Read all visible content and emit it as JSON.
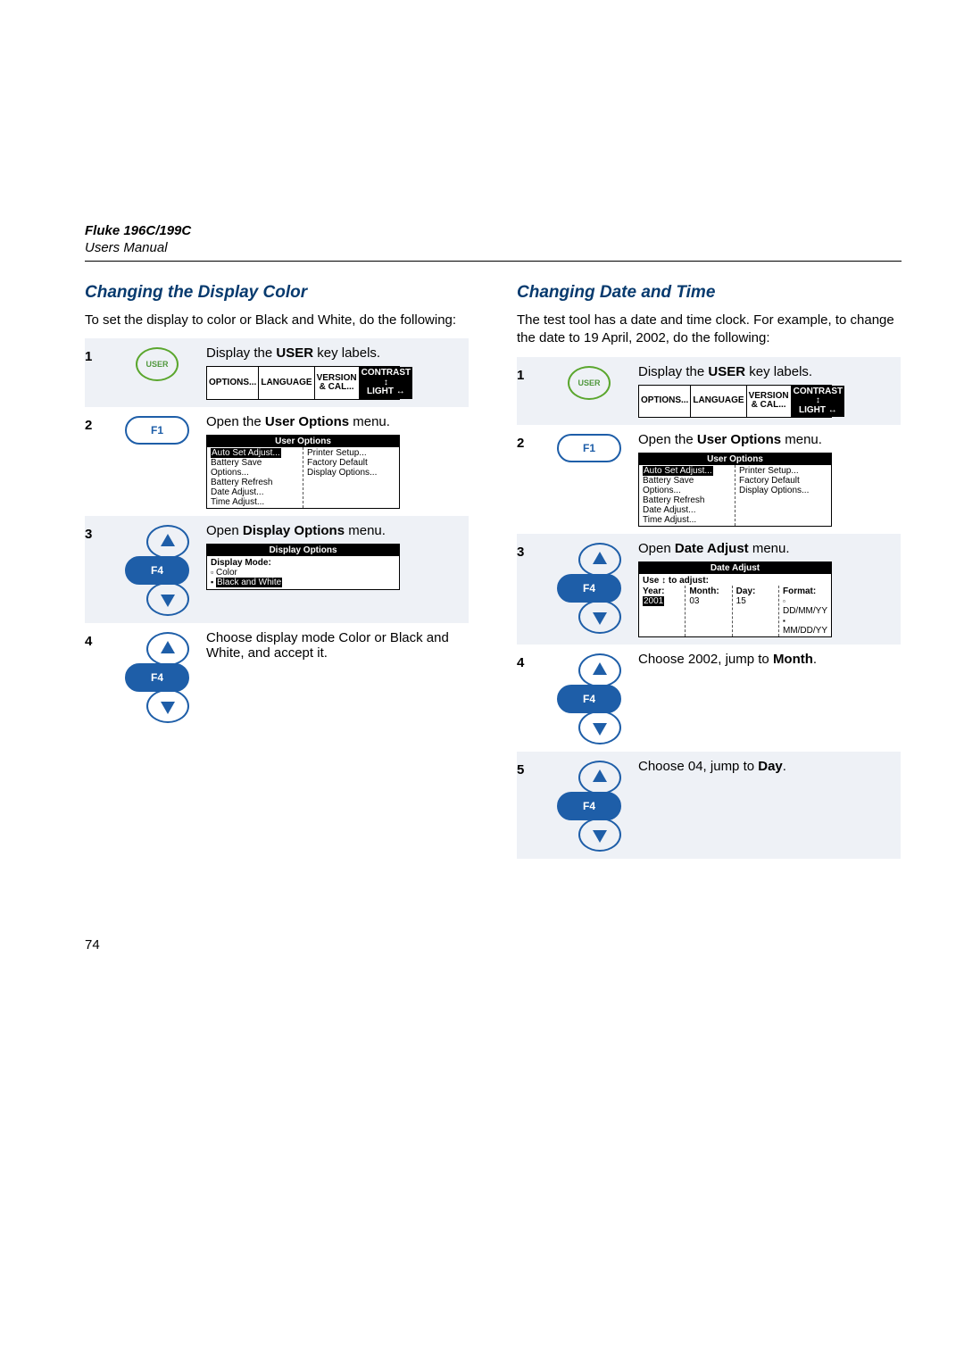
{
  "header": {
    "model": "Fluke 196C/199C",
    "subhead": "Users Manual"
  },
  "softkeys": {
    "options": "OPTIONS...",
    "language": "LANGUAGE",
    "version": "VERSION & CAL...",
    "contrast_top": "CONTRAST ↕",
    "contrast_bot": "LIGHT ↔"
  },
  "user_options_panel": {
    "title": "User Options",
    "left": [
      "Auto Set Adjust...",
      "Battery Save Options...",
      "Battery Refresh",
      "Date Adjust...",
      "Time Adjust..."
    ],
    "right": [
      "Printer Setup...",
      "Factory Default",
      "Display Options..."
    ]
  },
  "display_options_panel": {
    "title": "Display Options",
    "mode_label": "Display Mode:",
    "opt_color": "Color",
    "opt_bw": "Black and White"
  },
  "date_adjust_panel": {
    "title": "Date Adjust",
    "hint": "Use ↕ to adjust:",
    "cols": {
      "year_label": "Year:",
      "month_label": "Month:",
      "day_label": "Day:",
      "format_label": "Format:",
      "year_val": "2001",
      "month_val": "03",
      "day_val": "15",
      "fmt1": "DD/MM/YY",
      "fmt2": "MM/DD/YY"
    }
  },
  "left_section": {
    "title": "Changing the Display Color",
    "intro": "To set the display to color or Black and White, do the following:",
    "steps": {
      "s1": "Display the USER key labels.",
      "s2": "Open the User Options menu.",
      "s3": "Open Display Options menu.",
      "s4": "Choose display mode Color or Black and White, and accept it."
    }
  },
  "right_section": {
    "title": "Changing Date and Time",
    "intro": "The test tool has a date and time clock. For example, to change the date to 19 April, 2002, do the following:",
    "steps": {
      "s1": "Display the USER key labels.",
      "s2": "Open the User Options menu.",
      "s3": "Open Date Adjust menu.",
      "s4_a": "Choose 2002, jump to ",
      "s4_b": "Month",
      "s4_c": ".",
      "s5_a": "Choose 04, jump to ",
      "s5_b": "Day",
      "s5_c": "."
    }
  },
  "page_number": "74"
}
